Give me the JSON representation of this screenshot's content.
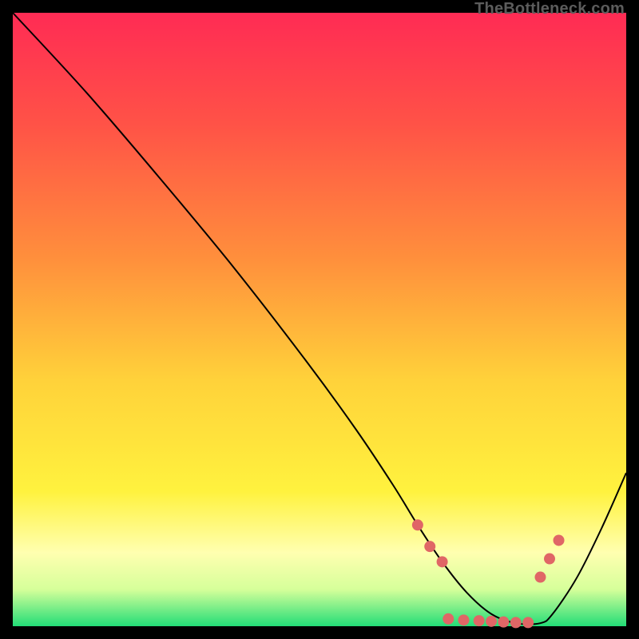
{
  "watermark": "TheBottleneck.com",
  "chart_data": {
    "type": "line",
    "title": "",
    "xlabel": "",
    "ylabel": "",
    "xlim": [
      0,
      100
    ],
    "ylim": [
      0,
      100
    ],
    "grid": false,
    "legend": false,
    "background_gradient": {
      "stops": [
        {
          "offset": 0.0,
          "color": "#ff2b54"
        },
        {
          "offset": 0.18,
          "color": "#ff5247"
        },
        {
          "offset": 0.4,
          "color": "#ff8f3c"
        },
        {
          "offset": 0.6,
          "color": "#ffd23a"
        },
        {
          "offset": 0.78,
          "color": "#fff23e"
        },
        {
          "offset": 0.88,
          "color": "#ffffb0"
        },
        {
          "offset": 0.94,
          "color": "#d6ff9a"
        },
        {
          "offset": 1.0,
          "color": "#22dd77"
        }
      ]
    },
    "series": [
      {
        "name": "bottleneck-curve",
        "color": "#000000",
        "width": 2,
        "x": [
          0.0,
          12.0,
          24.0,
          36.0,
          48.0,
          56.0,
          62.0,
          66.0,
          70.0,
          74.0,
          78.0,
          82.0,
          86.0,
          88.0,
          92.0,
          96.0,
          100.0
        ],
        "y": [
          100.0,
          87.0,
          73.0,
          58.5,
          43.0,
          32.0,
          23.0,
          16.5,
          10.5,
          5.5,
          2.0,
          0.5,
          0.5,
          2.0,
          8.0,
          16.0,
          25.0
        ]
      },
      {
        "name": "optimal-zone-markers",
        "color": "#e06666",
        "marker_radius": 7,
        "points_xy": [
          [
            66.0,
            16.5
          ],
          [
            68.0,
            13.0
          ],
          [
            70.0,
            10.5
          ],
          [
            71.0,
            1.2
          ],
          [
            73.5,
            1.0
          ],
          [
            76.0,
            0.9
          ],
          [
            78.0,
            0.8
          ],
          [
            80.0,
            0.7
          ],
          [
            82.0,
            0.6
          ],
          [
            84.0,
            0.6
          ],
          [
            86.0,
            8.0
          ],
          [
            87.5,
            11.0
          ],
          [
            89.0,
            14.0
          ]
        ]
      }
    ]
  }
}
